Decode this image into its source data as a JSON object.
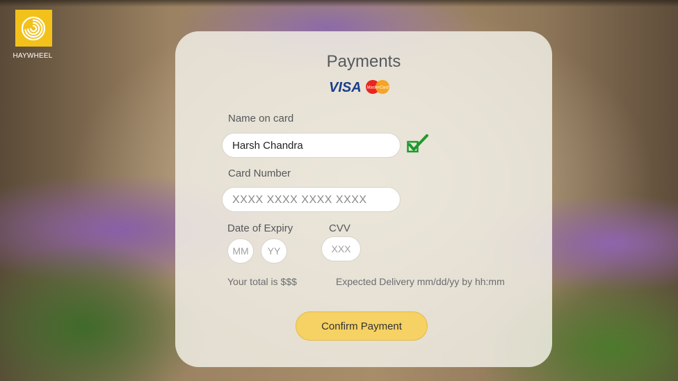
{
  "brand": {
    "name": "HAYWHEEL",
    "logo_icon": "spiral-icon",
    "logo_color": "#f2c21b"
  },
  "payment": {
    "title": "Payments",
    "card_logos": [
      "VISA",
      "MasterCard"
    ],
    "name_label": "Name on card",
    "name_value": "Harsh Chandra",
    "name_valid_icon": "checkmark-icon",
    "card_number_label": "Card Number",
    "card_number_placeholder": "XXXX XXXX XXXX XXXX",
    "expiry_label": "Date of Expiry",
    "expiry_month_placeholder": "MM",
    "expiry_year_placeholder": "YY",
    "cvv_label": "CVV",
    "cvv_placeholder": "XXX",
    "total_text": "Your total is $$$",
    "delivery_text": "Expected Delivery mm/dd/yy by hh:mm",
    "confirm_label": "Confirm Payment"
  },
  "colors": {
    "accent": "#f6d163",
    "check": "#1e9a2e",
    "visa_blue": "#1a3e8c"
  }
}
